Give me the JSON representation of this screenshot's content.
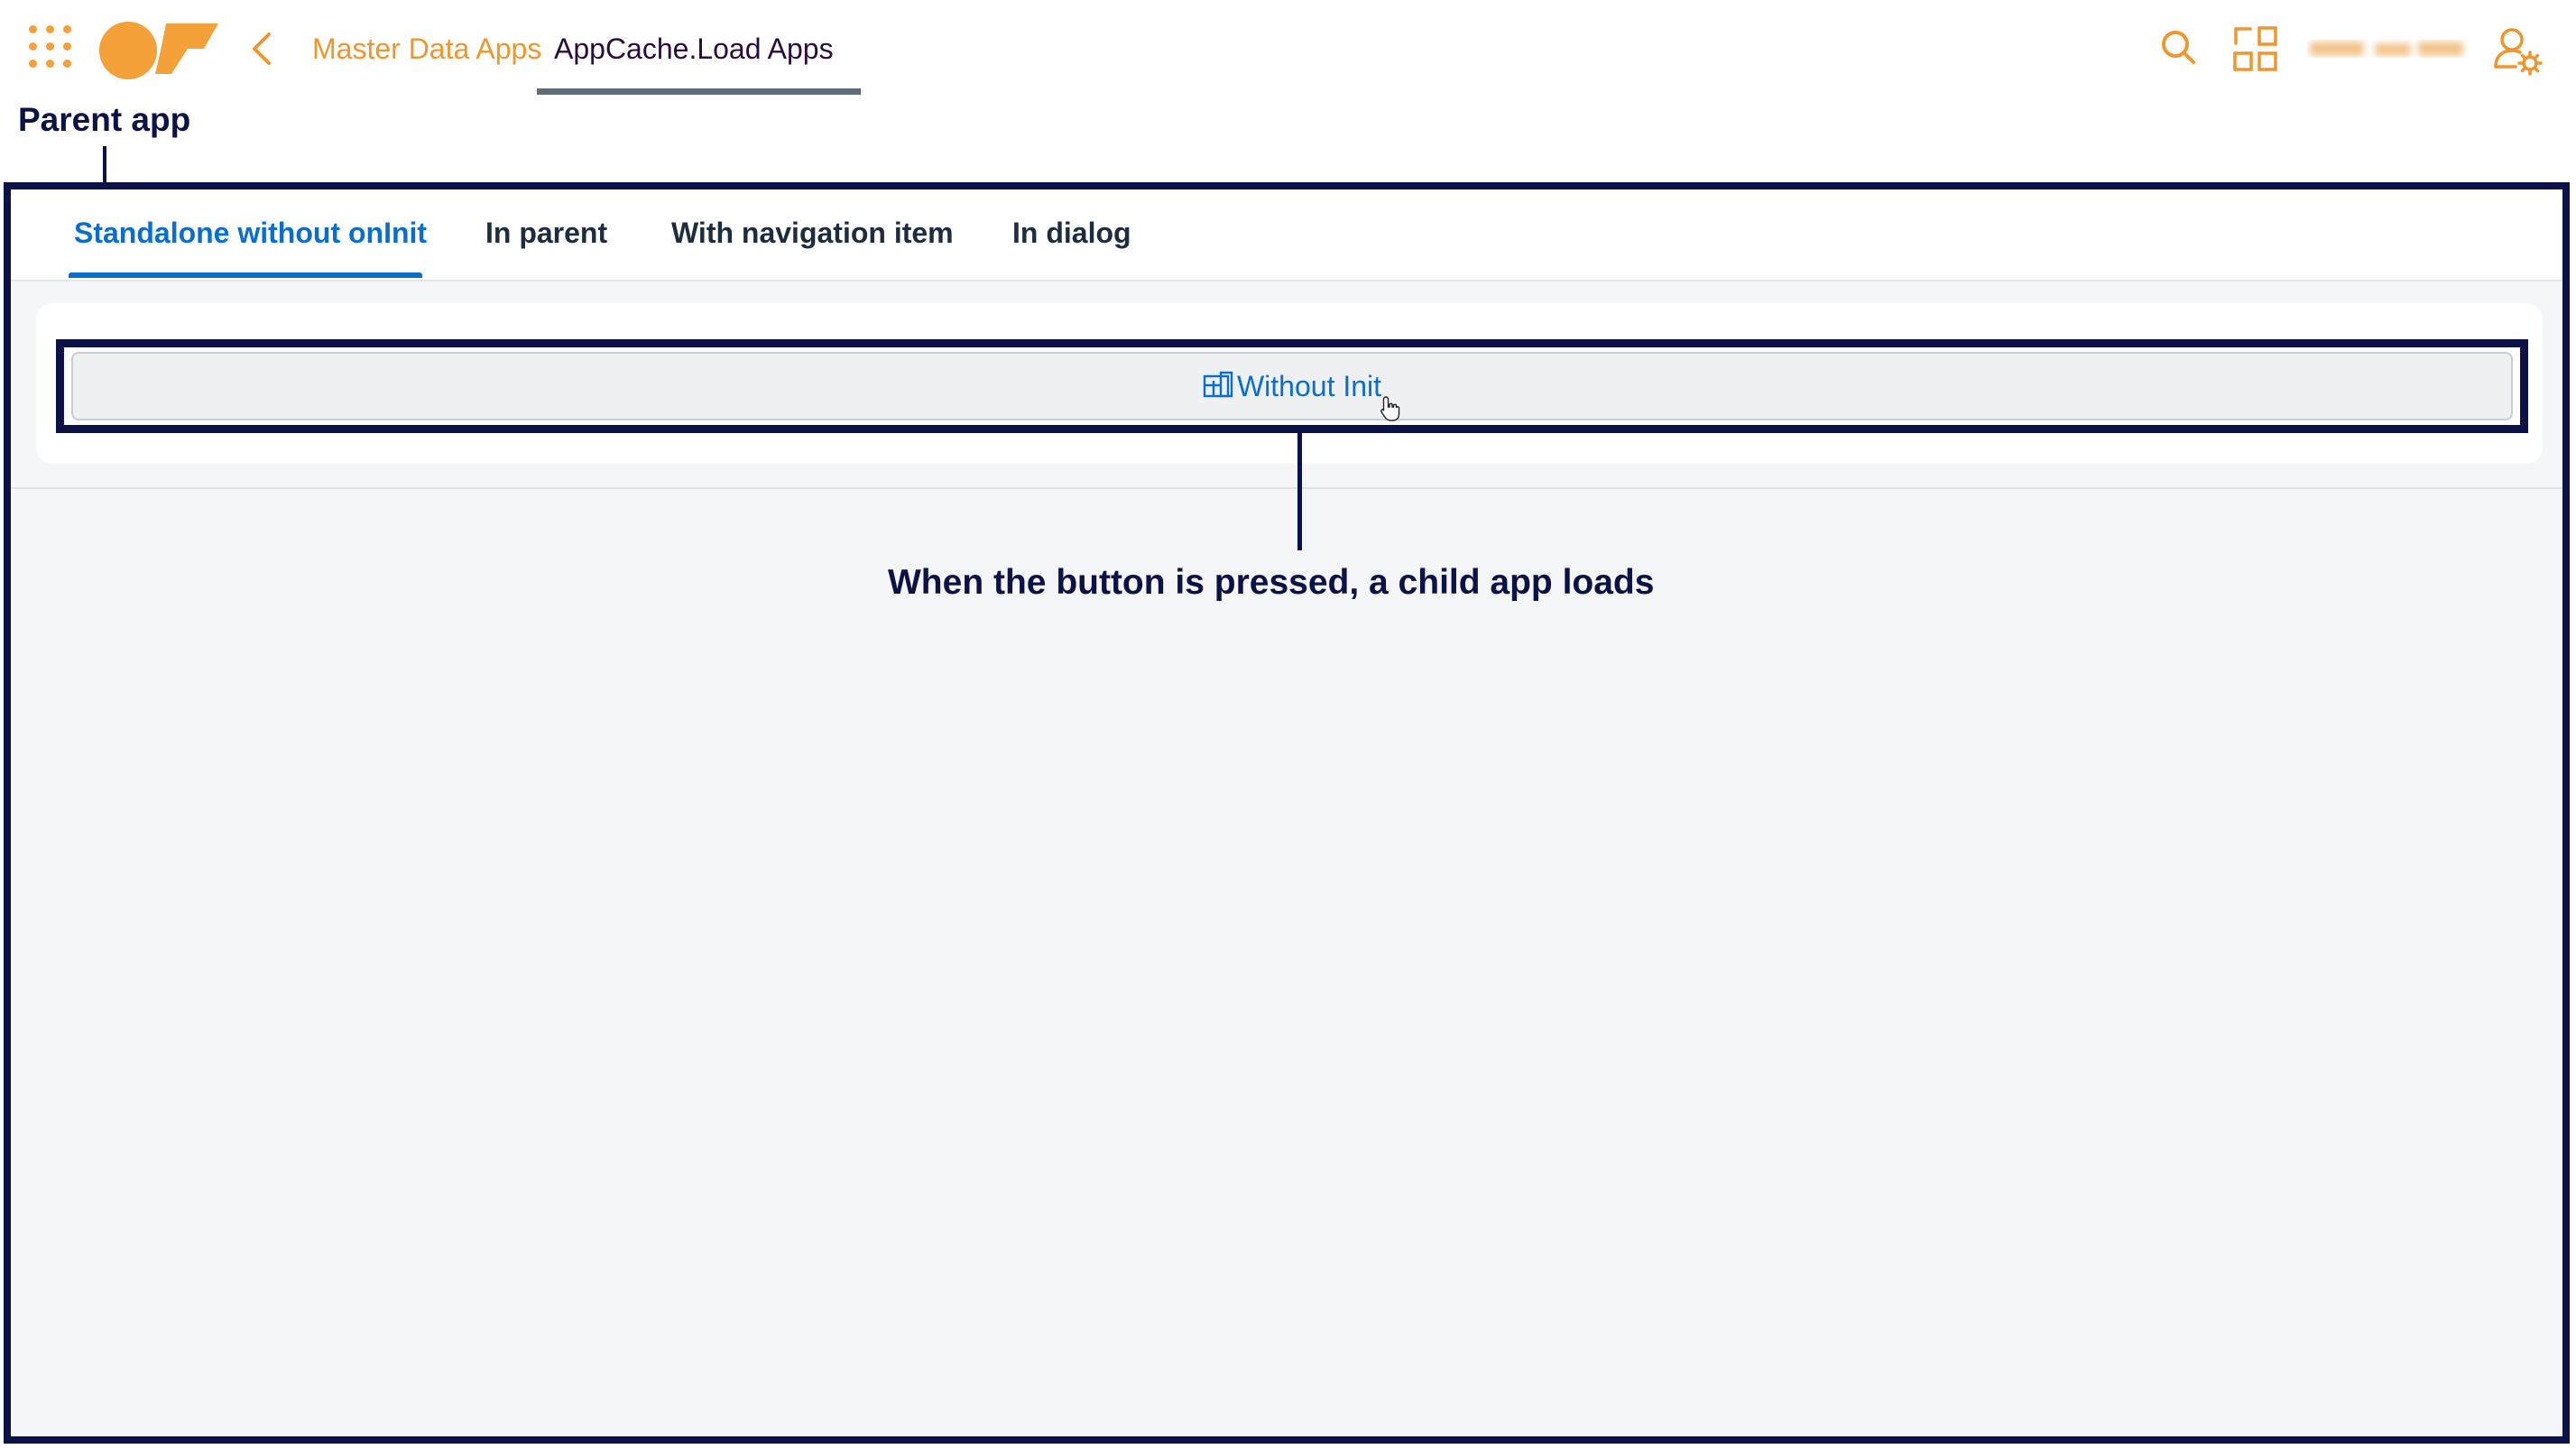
{
  "shell": {
    "breadcrumb": {
      "parent": "Master Data Apps",
      "current": "AppCache.Load Apps"
    },
    "icons": {
      "launcher": "app-launcher-grid-icon",
      "logo": "company-logo",
      "back": "chevron-left-icon",
      "search": "search-icon",
      "apps": "app-tiles-icon",
      "user_settings": "user-settings-icon"
    },
    "accent_color": "#f0962d"
  },
  "annotations": {
    "parent_label": "Parent app",
    "caption": "When the button is pressed, a child app loads",
    "color": "#0d1246"
  },
  "tabs": {
    "items": [
      {
        "label": "Standalone without onInit",
        "active": true
      },
      {
        "label": "In parent",
        "active": false
      },
      {
        "label": "With navigation item",
        "active": false
      },
      {
        "label": "In dialog",
        "active": false
      }
    ],
    "active_color": "#0a6ed1"
  },
  "main": {
    "button": {
      "label": "Without Init",
      "icon": "app-window-icon"
    }
  }
}
